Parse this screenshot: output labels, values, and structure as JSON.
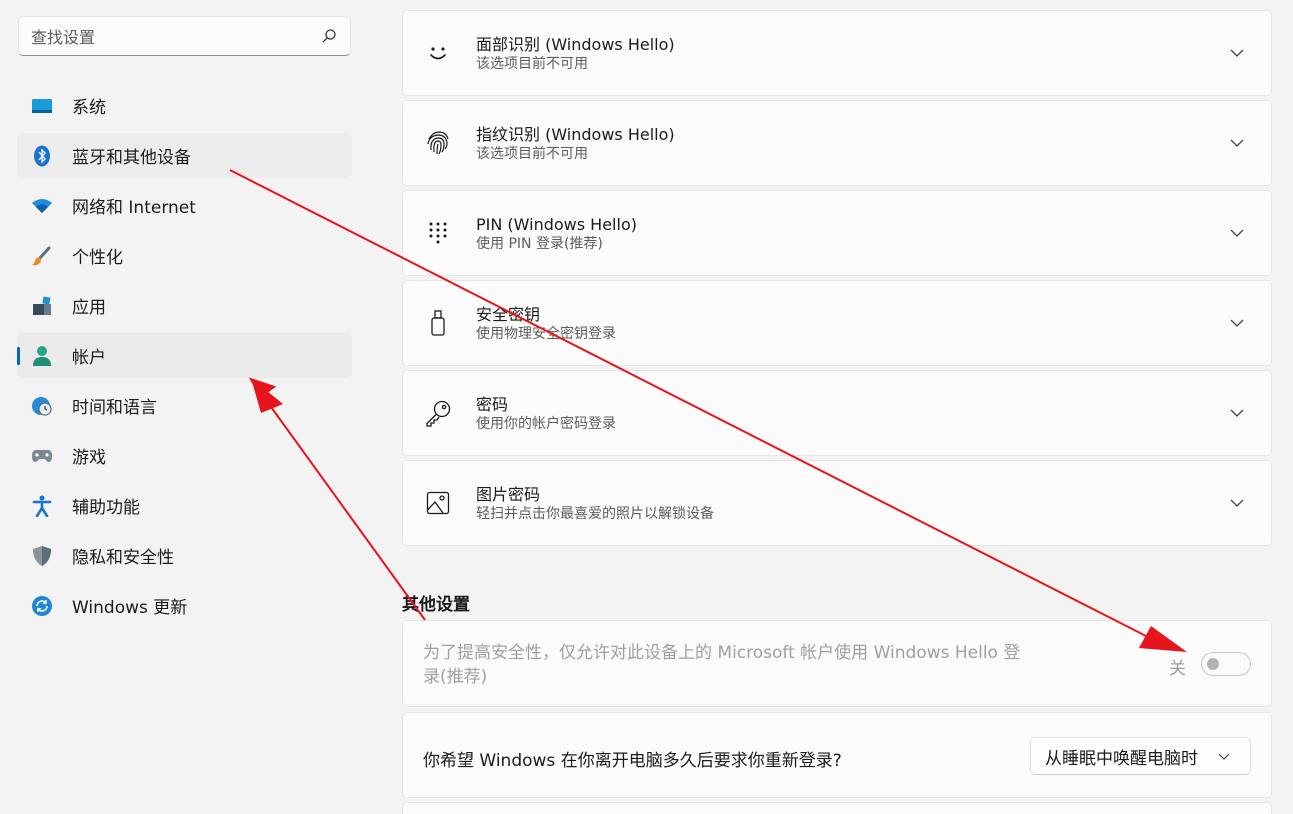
{
  "search": {
    "placeholder": "查找设置",
    "icon": "search-icon"
  },
  "sidebar": {
    "items": [
      {
        "label": "系统",
        "icon": "system-icon"
      },
      {
        "label": "蓝牙和其他设备",
        "icon": "bluetooth-icon"
      },
      {
        "label": "网络和 Internet",
        "icon": "wifi-icon"
      },
      {
        "label": "个性化",
        "icon": "brush-icon"
      },
      {
        "label": "应用",
        "icon": "apps-icon"
      },
      {
        "label": "帐户",
        "icon": "account-icon",
        "active": true
      },
      {
        "label": "时间和语言",
        "icon": "clock-globe-icon"
      },
      {
        "label": "游戏",
        "icon": "gamepad-icon"
      },
      {
        "label": "辅助功能",
        "icon": "accessibility-icon"
      },
      {
        "label": "隐私和安全性",
        "icon": "shield-icon"
      },
      {
        "label": "Windows 更新",
        "icon": "update-icon"
      }
    ]
  },
  "signin_options": [
    {
      "title": "面部识别 (Windows Hello)",
      "subtitle": "该选项目前不可用",
      "icon": "face-icon"
    },
    {
      "title": "指纹识别 (Windows Hello)",
      "subtitle": "该选项目前不可用",
      "icon": "fingerprint-icon"
    },
    {
      "title": "PIN (Windows Hello)",
      "subtitle": "使用 PIN 登录(推荐)",
      "icon": "pin-keypad-icon"
    },
    {
      "title": "安全密钥",
      "subtitle": "使用物理安全密钥登录",
      "icon": "usb-key-icon"
    },
    {
      "title": "密码",
      "subtitle": "使用你的帐户密码登录",
      "icon": "key-icon"
    },
    {
      "title": "图片密码",
      "subtitle": "轻扫并点击你最喜爱的照片以解锁设备",
      "icon": "picture-icon"
    }
  ],
  "other_settings": {
    "title": "其他设置",
    "hello_only": {
      "text": "为了提高安全性，仅允许对此设备上的 Microsoft 帐户使用 Windows Hello 登录(推荐)",
      "toggle_label": "关",
      "toggle_on": false
    },
    "require_signin": {
      "text": "你希望 Windows 在你离开电脑多久后要求你重新登录?",
      "selected": "从睡眠中唤醒电脑时"
    }
  },
  "colors": {
    "accent": "#0067c0",
    "annotation_arrow": "#e8141b"
  }
}
